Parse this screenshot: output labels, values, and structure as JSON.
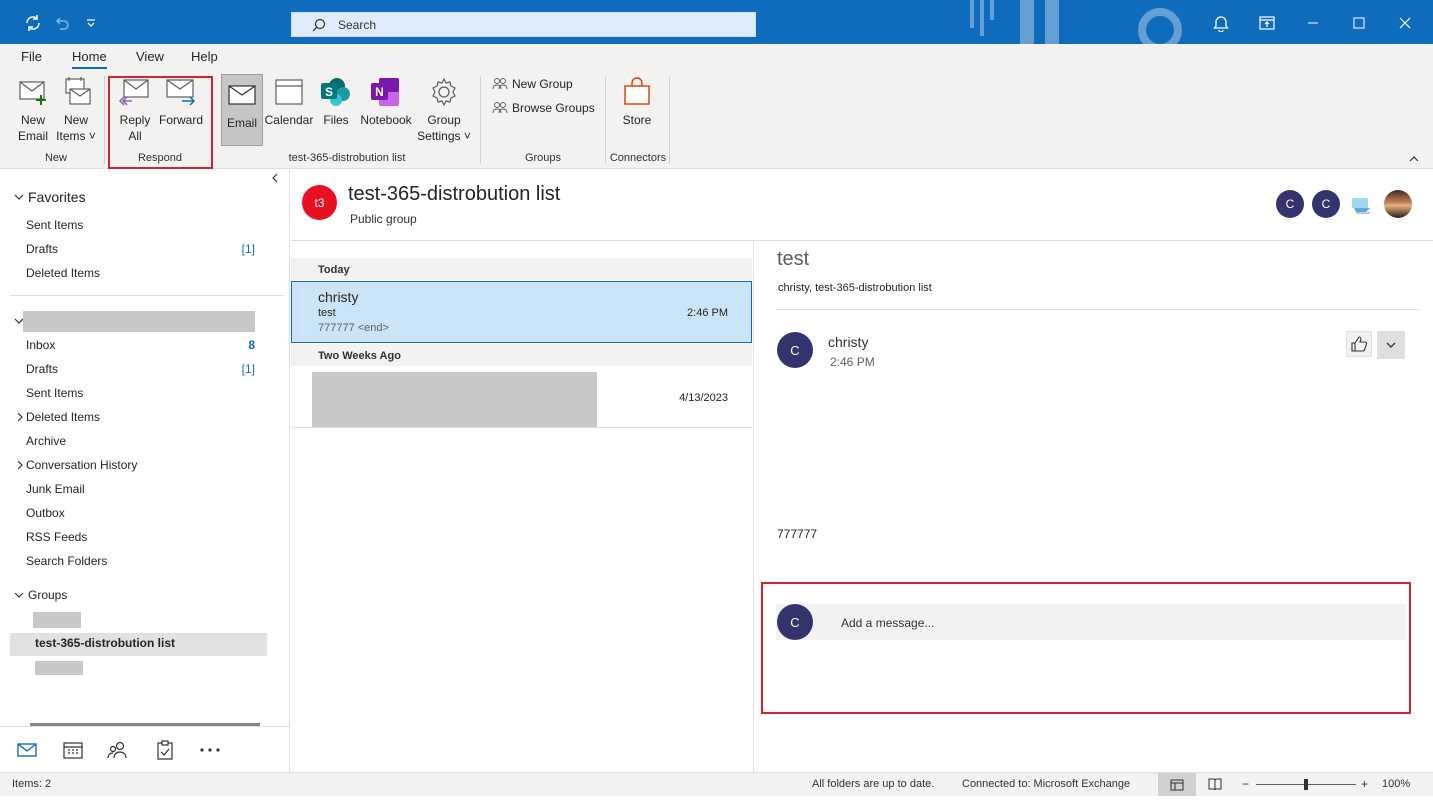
{
  "search": {
    "placeholder": "Search"
  },
  "menu": {
    "tabs": [
      "File",
      "Home",
      "View",
      "Help"
    ],
    "active": "Home"
  },
  "ribbon": {
    "new_email": [
      "New",
      "Email"
    ],
    "new_items": [
      "New",
      "Items ˅"
    ],
    "reply_all": [
      "Reply",
      "All"
    ],
    "forward": "Forward",
    "email": "Email",
    "calendar": "Calendar",
    "files": "Files",
    "notebook": "Notebook",
    "group_settings": [
      "Group",
      "Settings ˅"
    ],
    "new_group": "New Group",
    "browse_groups": "Browse Groups",
    "store": "Store",
    "groups": {
      "new": "New",
      "respond": "Respond",
      "list": "test-365-distrobution list",
      "groups": "Groups",
      "connectors": "Connectors"
    }
  },
  "folders": {
    "favorites": {
      "title": "Favorites",
      "items": [
        {
          "label": "Sent Items",
          "count": ""
        },
        {
          "label": "Drafts",
          "count": "[1]"
        },
        {
          "label": "Deleted Items",
          "count": ""
        }
      ]
    },
    "mailbox": {
      "items": [
        {
          "label": "Inbox",
          "count": "8"
        },
        {
          "label": "Drafts",
          "count": "[1]"
        },
        {
          "label": "Sent Items",
          "count": ""
        },
        {
          "label": "Deleted Items",
          "count": ""
        },
        {
          "label": "Archive",
          "count": ""
        },
        {
          "label": "Conversation History",
          "count": ""
        },
        {
          "label": "Junk Email",
          "count": ""
        },
        {
          "label": "Outbox",
          "count": ""
        },
        {
          "label": "RSS Feeds",
          "count": ""
        },
        {
          "label": "Search Folders",
          "count": ""
        }
      ]
    },
    "groups": {
      "title": "Groups",
      "selected": "test-365-distrobution list"
    }
  },
  "group_header": {
    "initials": "t3",
    "title": "test-365-distrobution list",
    "subtitle": "Public group",
    "members": [
      "C",
      "C"
    ]
  },
  "message_list": {
    "today": "Today",
    "two_weeks_ago": "Two Weeks Ago",
    "messages": [
      {
        "sender": "christy",
        "subject": "test",
        "preview": "777777 <end>",
        "time": "2:46 PM"
      },
      {
        "sender": "",
        "subject": "",
        "preview": "",
        "time": "4/13/2023"
      }
    ]
  },
  "reading": {
    "subject": "test",
    "participants": "christy, test-365-distrobution list",
    "sender": "christy",
    "sender_initial": "C",
    "time": "2:46 PM",
    "body": "777777",
    "reply_initial": "C",
    "reply_placeholder": "Add a message..."
  },
  "status": {
    "items": "Items: 2",
    "sync": "All folders are up to date.",
    "connection": "Connected to: Microsoft Exchange",
    "zoom": "100%"
  },
  "colors": {
    "accent": "#0f6cbd",
    "highlight_box": "#d1242f",
    "group_avatar": "#e81123",
    "member_avatar": "#33346e"
  }
}
